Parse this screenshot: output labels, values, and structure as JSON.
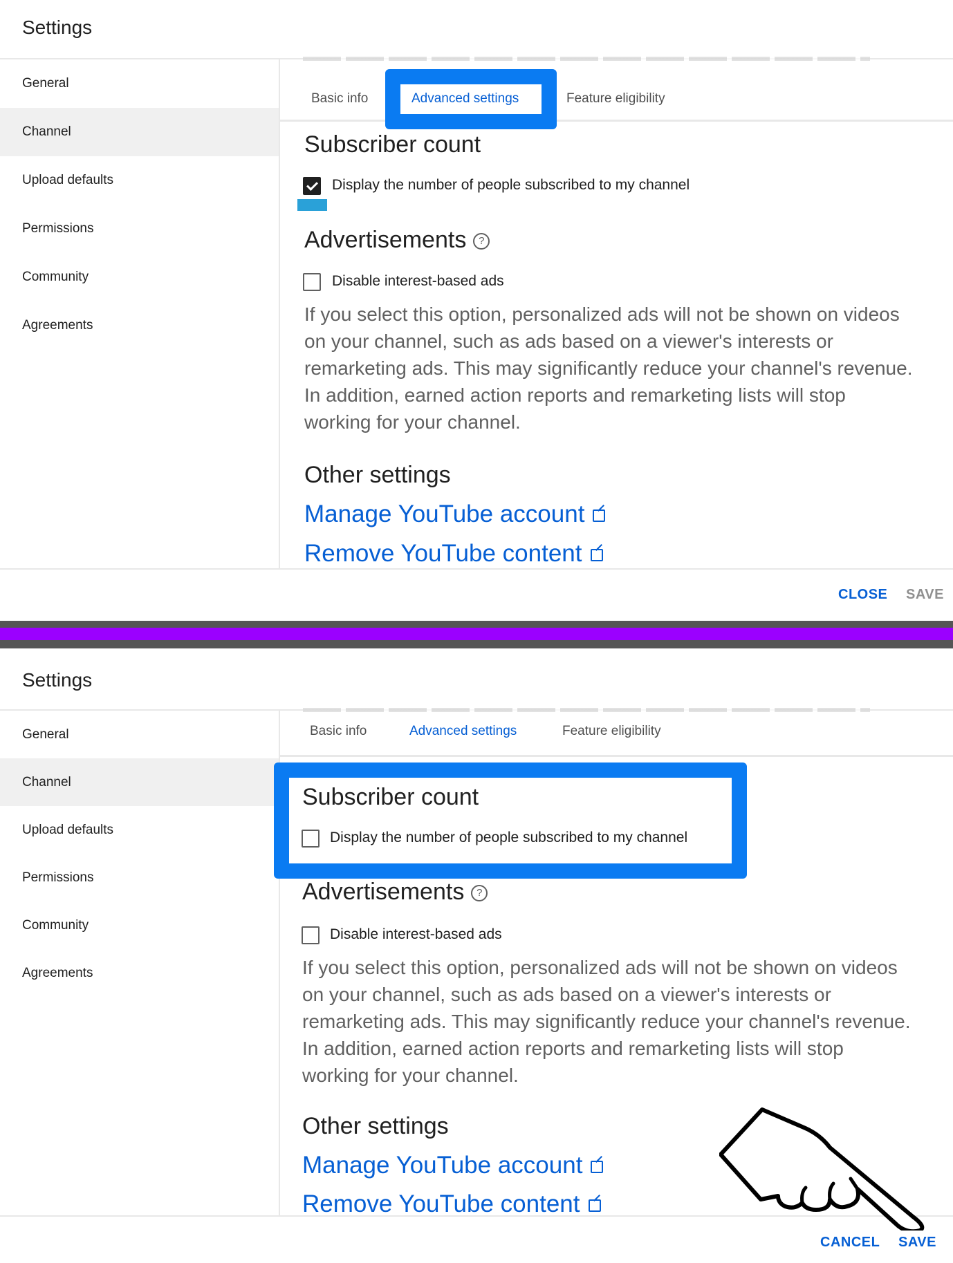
{
  "top": {
    "title": "Settings",
    "sidebar": [
      "General",
      "Channel",
      "Upload defaults",
      "Permissions",
      "Community",
      "Agreements"
    ],
    "active_sidebar": "Channel",
    "tabs": [
      "Basic info",
      "Advanced settings",
      "Feature eligibility"
    ],
    "selected_tab": "Advanced settings",
    "subscriber": {
      "heading": "Subscriber count",
      "checkbox_label": "Display the number of people subscribed to my channel",
      "checked": true
    },
    "ads": {
      "heading": "Advertisements",
      "help_icon": "?",
      "checkbox_label": "Disable interest-based ads",
      "checked": false,
      "description": "If you select this option, personalized ads will not be shown on videos on your channel, such as ads based on a viewer's interests or remarketing ads. This may significantly reduce your channel's revenue. In addition, earned action reports and remarketing lists will stop working for your channel."
    },
    "other": {
      "heading": "Other settings",
      "links": [
        "Manage YouTube account",
        "Remove YouTube content"
      ]
    },
    "footer": {
      "close": "CLOSE",
      "save": "SAVE"
    }
  },
  "bottom": {
    "title": "Settings",
    "sidebar": [
      "General",
      "Channel",
      "Upload defaults",
      "Permissions",
      "Community",
      "Agreements"
    ],
    "active_sidebar": "Channel",
    "tabs": [
      "Basic info",
      "Advanced settings",
      "Feature eligibility"
    ],
    "selected_tab": "Advanced settings",
    "subscriber": {
      "heading": "Subscriber count",
      "checkbox_label": "Display the number of people subscribed to my channel",
      "checked": false
    },
    "ads": {
      "heading": "Advertisements",
      "help_icon": "?",
      "checkbox_label": "Disable interest-based ads",
      "checked": false,
      "description": "If you select this option, personalized ads will not be shown on videos on your channel, such as ads based on a viewer's interests or remarketing ads. This may significantly reduce your channel's revenue. In addition, earned action reports and remarketing lists will stop working for your channel."
    },
    "other": {
      "heading": "Other settings",
      "links": [
        "Manage YouTube account",
        "Remove YouTube content"
      ]
    },
    "footer": {
      "cancel": "CANCEL",
      "save": "SAVE"
    }
  },
  "colors": {
    "accent": "#065fd4",
    "highlight": "#0a7bf2",
    "separator": "#9b00ff"
  },
  "icons": [
    "help-icon",
    "external-link-icon",
    "checkbox-checked-icon",
    "pointing-hand-icon"
  ]
}
